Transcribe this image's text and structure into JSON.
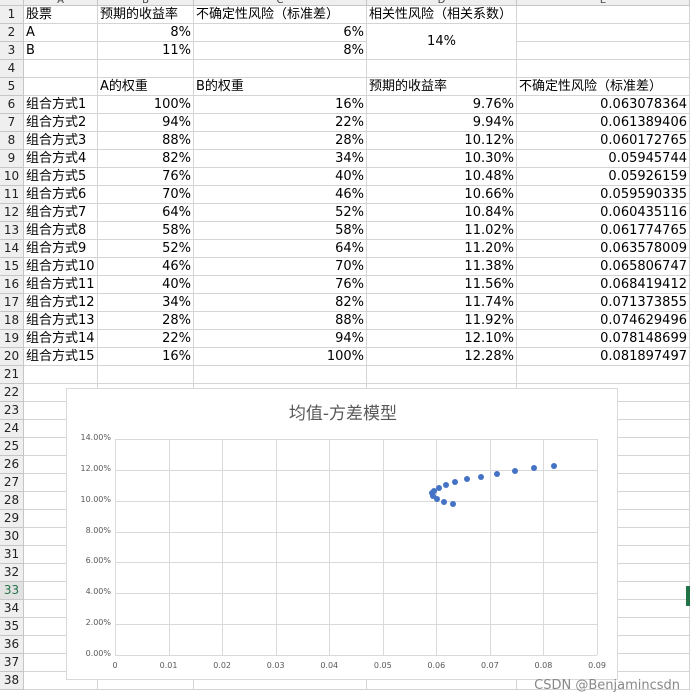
{
  "column_headers": [
    "A",
    "B",
    "C",
    "D",
    "E"
  ],
  "row_headers": [
    "1",
    "2",
    "3",
    "4",
    "5",
    "6",
    "7",
    "8",
    "9",
    "10",
    "11",
    "12",
    "13",
    "14",
    "15",
    "16",
    "17",
    "18",
    "19",
    "20",
    "21",
    "22",
    "23",
    "24",
    "25",
    "26",
    "27",
    "28",
    "29",
    "30",
    "31",
    "32",
    "33",
    "34",
    "35",
    "36",
    "37",
    "38"
  ],
  "selected_row": "33",
  "top_table": {
    "headers": [
      "股票",
      "预期的收益率",
      "不确定性风险（标准差）",
      "相关性风险（相关系数）"
    ],
    "rows": [
      {
        "stock": "A",
        "return": "8%",
        "risk": "6%"
      },
      {
        "stock": "B",
        "return": "11%",
        "risk": "8%"
      }
    ],
    "correlation": "14%"
  },
  "portfolio_table": {
    "headers": [
      "A的权重",
      "B的权重",
      "预期的收益率",
      "不确定性风险（标准差）"
    ],
    "rows": [
      {
        "name": "组合方式1",
        "wa": "100%",
        "wb": "16%",
        "ret": "9.76%",
        "sd": "0.063078364"
      },
      {
        "name": "组合方式2",
        "wa": "94%",
        "wb": "22%",
        "ret": "9.94%",
        "sd": "0.061389406"
      },
      {
        "name": "组合方式3",
        "wa": "88%",
        "wb": "28%",
        "ret": "10.12%",
        "sd": "0.060172765"
      },
      {
        "name": "组合方式4",
        "wa": "82%",
        "wb": "34%",
        "ret": "10.30%",
        "sd": "0.05945744"
      },
      {
        "name": "组合方式5",
        "wa": "76%",
        "wb": "40%",
        "ret": "10.48%",
        "sd": "0.05926159"
      },
      {
        "name": "组合方式6",
        "wa": "70%",
        "wb": "46%",
        "ret": "10.66%",
        "sd": "0.059590335"
      },
      {
        "name": "组合方式7",
        "wa": "64%",
        "wb": "52%",
        "ret": "10.84%",
        "sd": "0.060435116"
      },
      {
        "name": "组合方式8",
        "wa": "58%",
        "wb": "58%",
        "ret": "11.02%",
        "sd": "0.061774765"
      },
      {
        "name": "组合方式9",
        "wa": "52%",
        "wb": "64%",
        "ret": "11.20%",
        "sd": "0.063578009"
      },
      {
        "name": "组合方式10",
        "wa": "46%",
        "wb": "70%",
        "ret": "11.38%",
        "sd": "0.065806747"
      },
      {
        "name": "组合方式11",
        "wa": "40%",
        "wb": "76%",
        "ret": "11.56%",
        "sd": "0.068419412"
      },
      {
        "name": "组合方式12",
        "wa": "34%",
        "wb": "82%",
        "ret": "11.74%",
        "sd": "0.071373855"
      },
      {
        "name": "组合方式13",
        "wa": "28%",
        "wb": "88%",
        "ret": "11.92%",
        "sd": "0.074629496"
      },
      {
        "name": "组合方式14",
        "wa": "22%",
        "wb": "94%",
        "ret": "12.10%",
        "sd": "0.078148699"
      },
      {
        "name": "组合方式15",
        "wa": "16%",
        "wb": "100%",
        "ret": "12.28%",
        "sd": "0.081897497"
      }
    ]
  },
  "chart_data": {
    "type": "scatter",
    "title": "均值-方差模型",
    "xlabel": "",
    "ylabel": "",
    "xlim": [
      0,
      0.09
    ],
    "ylim": [
      0,
      0.14
    ],
    "x_ticks": [
      "0",
      "0.01",
      "0.02",
      "0.03",
      "0.04",
      "0.05",
      "0.06",
      "0.07",
      "0.08",
      "0.09"
    ],
    "y_ticks": [
      "0.00%",
      "2.00%",
      "4.00%",
      "6.00%",
      "8.00%",
      "10.00%",
      "12.00%",
      "14.00%"
    ],
    "grid": true,
    "series": [
      {
        "x": [
          0.063078364,
          0.061389406,
          0.060172765,
          0.05945744,
          0.05926159,
          0.059590335,
          0.060435116,
          0.061774765,
          0.063578009,
          0.065806747,
          0.068419412,
          0.071373855,
          0.074629496,
          0.078148699,
          0.081897497
        ],
        "y": [
          0.0976,
          0.0994,
          0.1012,
          0.103,
          0.1048,
          0.1066,
          0.1084,
          0.1102,
          0.112,
          0.1138,
          0.1156,
          0.1174,
          0.1192,
          0.121,
          0.1228
        ]
      }
    ],
    "marker_color": "#4472c4"
  },
  "watermark": "CSDN @Benjamincsdn"
}
